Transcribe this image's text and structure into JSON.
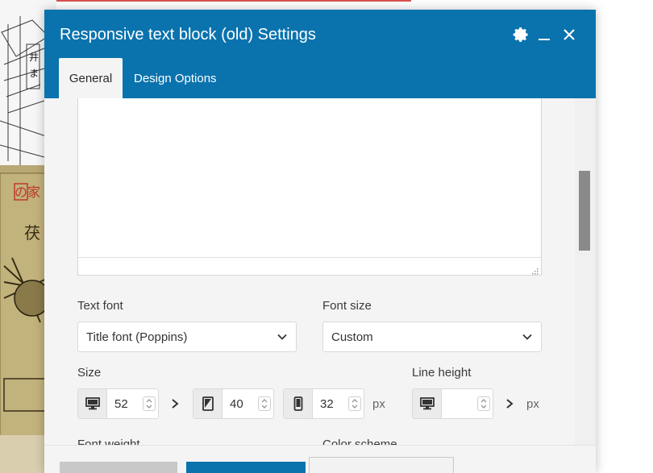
{
  "dialog": {
    "title": "Responsive text block (old) Settings",
    "tabs": [
      {
        "label": "General",
        "active": true
      },
      {
        "label": "Design Options",
        "active": false
      }
    ],
    "header_icons": [
      "gear-icon",
      "minimize-icon",
      "close-icon"
    ]
  },
  "fields": {
    "text_font": {
      "label": "Text font",
      "value": "Title font (Poppins)"
    },
    "font_size": {
      "label": "Font size",
      "value": "Custom"
    },
    "size": {
      "label": "Size",
      "desktop": "52",
      "tablet": "40",
      "mobile": "32",
      "unit": "px"
    },
    "line_height": {
      "label": "Line height",
      "desktop": "",
      "unit": "px"
    },
    "font_weight": {
      "label": "Font weight"
    },
    "color_scheme": {
      "label": "Color scheme"
    }
  },
  "colors": {
    "header_bg": "#0a73ad",
    "dialog_bg": "#f4f4f4",
    "tab_active_bg": "#f4f4f4"
  }
}
